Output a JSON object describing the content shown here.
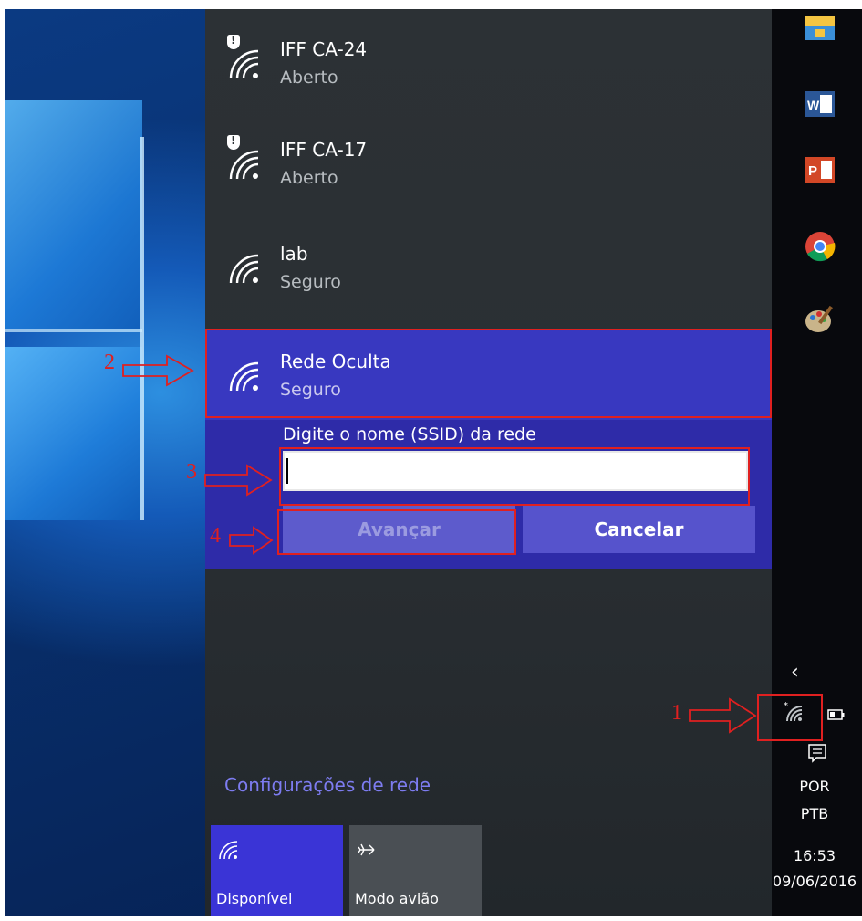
{
  "networks": [
    {
      "ssid": "IFF CA-24",
      "status": "Aberto"
    },
    {
      "ssid": "IFF CA-17",
      "status": "Aberto"
    },
    {
      "ssid": "lab",
      "status": "Seguro"
    }
  ],
  "selected_network": {
    "ssid": "Rede Oculta",
    "status": "Seguro"
  },
  "hidden_prompt": {
    "label": "Digite o nome (SSID) da rede",
    "input_value": "",
    "next_label": "Avançar",
    "cancel_label": "Cancelar"
  },
  "settings_link": "Configurações de rede",
  "quick_actions": [
    {
      "label": "Disponível",
      "icon": "wifi-icon"
    },
    {
      "label": "Modo avião",
      "icon": "airplane-icon"
    }
  ],
  "annotations": [
    "1",
    "2",
    "3",
    "4"
  ],
  "taskbar": {
    "apps": [
      "file-explorer-icon",
      "word-icon",
      "powerpoint-icon",
      "chrome-icon",
      "paint-icon"
    ],
    "language_line1": "POR",
    "language_line2": "PTB",
    "time": "16:53",
    "date": "09/06/2016"
  },
  "colors": {
    "selected_bg": "#3838c0",
    "accent_link": "#7d7cf0",
    "annotation": "#e02020"
  }
}
